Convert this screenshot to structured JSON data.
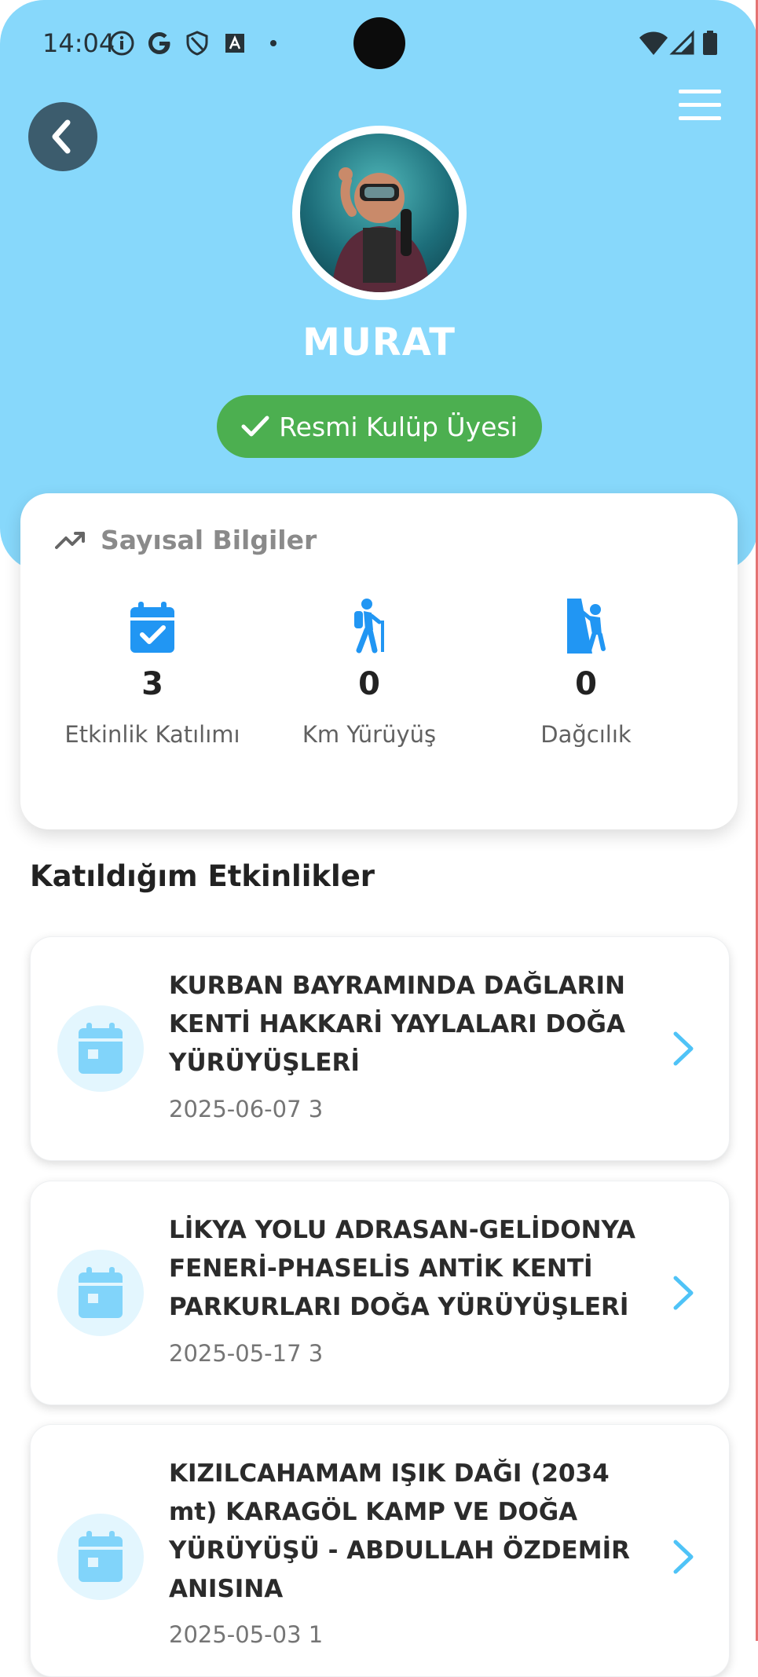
{
  "status_bar": {
    "time": "14:04"
  },
  "profile": {
    "name": "MURAT",
    "badge": "Resmi Kulüp Üyesi"
  },
  "stats": {
    "title": "Sayısal Bilgiler",
    "items": [
      {
        "icon": "calendar-check-icon",
        "value": "3",
        "label": "Etkinlik Katılımı"
      },
      {
        "icon": "hiker-icon",
        "value": "0",
        "label": "Km Yürüyüş"
      },
      {
        "icon": "climber-icon",
        "value": "0",
        "label": "Dağcılık"
      }
    ]
  },
  "events_section": {
    "title": "Katıldığım Etkinlikler",
    "events": [
      {
        "title": "KURBAN BAYRAMINDA DAĞLARIN KENTİ HAKKARİ YAYLALARI  DOĞA YÜRÜYÜŞLERİ",
        "meta": "2025-06-07 3"
      },
      {
        "title": "LİKYA YOLU ADRASAN-GELİDONYA FENERİ-PHASELİS ANTİK KENTİ PARKURLARI DOĞA YÜRÜYÜŞLERİ",
        "meta": "2025-05-17 3"
      },
      {
        "title": "KIZILCAHAMAM  IŞIK DAĞI (2034 mt) KARAGÖL KAMP VE DOĞA YÜRÜYÜŞÜ - ABDULLAH ÖZDEMİR ANISINA",
        "meta": "2025-05-03 1"
      }
    ]
  },
  "colors": {
    "header_bg": "#87d8fb",
    "badge_green": "#4caf50",
    "accent_blue": "#2196f3",
    "chevron_blue": "#4fc3f7",
    "back_button": "#3c5c6d"
  }
}
